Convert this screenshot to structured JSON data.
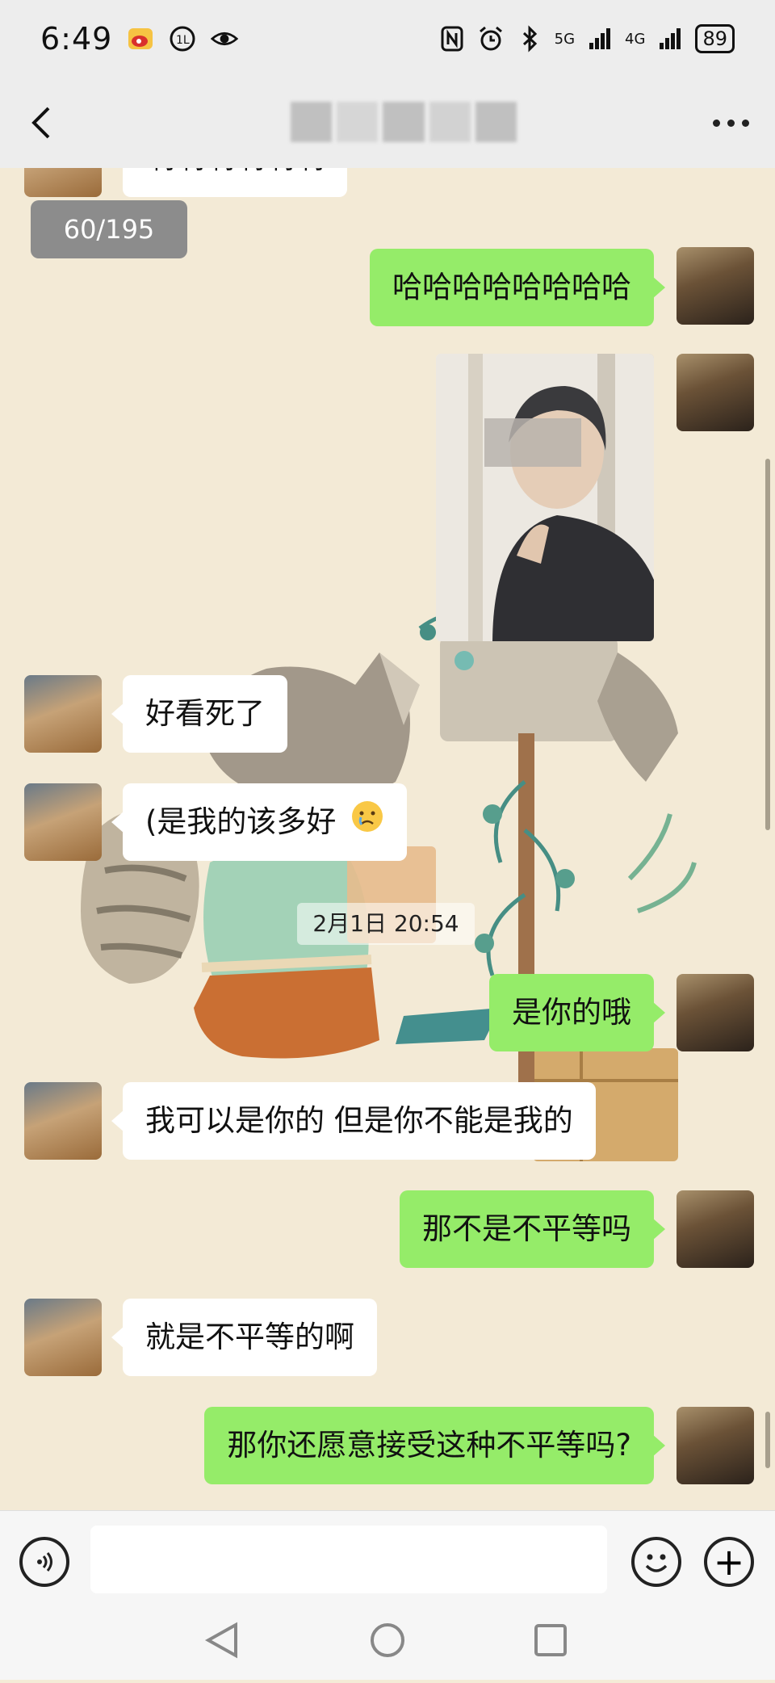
{
  "status_bar": {
    "time": "6:49",
    "signal_5g": "5G",
    "signal_4g": "4G",
    "battery": "89"
  },
  "header": {
    "title": ""
  },
  "chat": {
    "unread_counter": "60/195",
    "timestamp": "2月1日 20:54",
    "messages": [
      {
        "side": "left",
        "text": "啊啊啊啊啊啊"
      },
      {
        "side": "right",
        "text": "哈哈哈哈哈哈哈哈"
      },
      {
        "side": "right",
        "type": "image",
        "text": ""
      },
      {
        "side": "left",
        "text": "好看死了"
      },
      {
        "side": "left",
        "text": "(是我的该多好"
      },
      {
        "side": "right",
        "text": "是你的哦"
      },
      {
        "side": "left",
        "text": "我可以是你的 但是你不能是我的"
      },
      {
        "side": "right",
        "text": "那不是不平等吗"
      },
      {
        "side": "left",
        "text": "就是不平等的啊"
      },
      {
        "side": "right",
        "text": "那你还愿意接受这种不平等吗?"
      }
    ]
  },
  "input_bar": {
    "placeholder": ""
  },
  "icons": {
    "back": "chevron-left-icon",
    "more": "more-horizontal-icon",
    "voice": "voice-icon",
    "emoji": "emoji-icon",
    "plus": "plus-icon"
  },
  "colors": {
    "sent_bubble": "#95ec69",
    "received_bubble": "#ffffff",
    "chat_background": "#f3ead6"
  }
}
